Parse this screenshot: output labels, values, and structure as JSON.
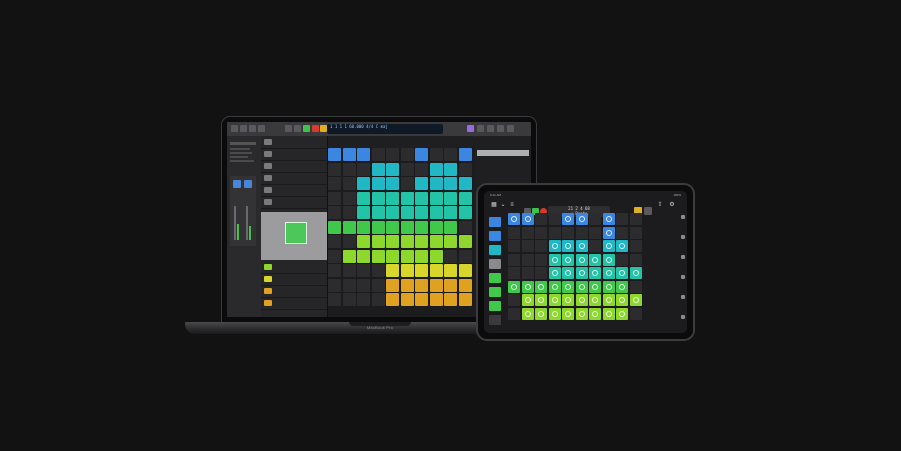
{
  "laptop": {
    "brand_label": "MacBook Pro",
    "lcd_text": "1 1 1 1  60.000  4/4  C maj",
    "tracks": [
      "",
      "",
      "",
      "",
      "",
      "",
      "",
      "",
      "",
      "",
      "",
      "",
      ""
    ]
  },
  "ipad": {
    "status_time": "9:41 AM",
    "status_right": "100%",
    "lcd_top": "21  2  4  68",
    "lcd_bottom": "♩ Beats"
  },
  "colors": {
    "blue": "#3a86e0",
    "teal": "#1fb8c4",
    "cyan": "#22c3a6",
    "green": "#3fc84a",
    "lime": "#8ed82e",
    "yellow": "#d8d62a",
    "orange": "#e0a020",
    "empty": "#2c2c2e"
  }
}
